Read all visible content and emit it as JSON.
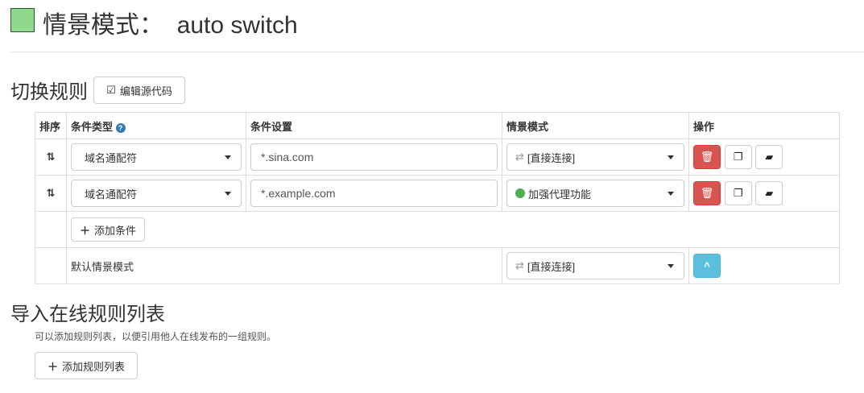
{
  "header": {
    "title": "情景模式：  auto switch",
    "color": "#8fd98f"
  },
  "rules": {
    "heading": "切换规则",
    "edit_source": "编辑源代码",
    "columns": [
      "排序",
      "条件类型",
      "条件设置",
      "情景模式",
      "操作"
    ],
    "rows": [
      {
        "type": "域名通配符",
        "pattern": "*.sina.com",
        "profile": "[直接连接]",
        "profile_icon": "direct-icon"
      },
      {
        "type": "域名通配符",
        "pattern": "*.example.com",
        "profile": "加强代理功能",
        "profile_icon": "globe-icon"
      }
    ],
    "add_condition": "添加条件",
    "default_label": "默认情景模式",
    "default_profile": "[直接连接]"
  },
  "import": {
    "heading": "导入在线规则列表",
    "description": "可以添加规则列表，以便引用他人在线发布的一组规则。",
    "add_list": "添加规则列表"
  }
}
